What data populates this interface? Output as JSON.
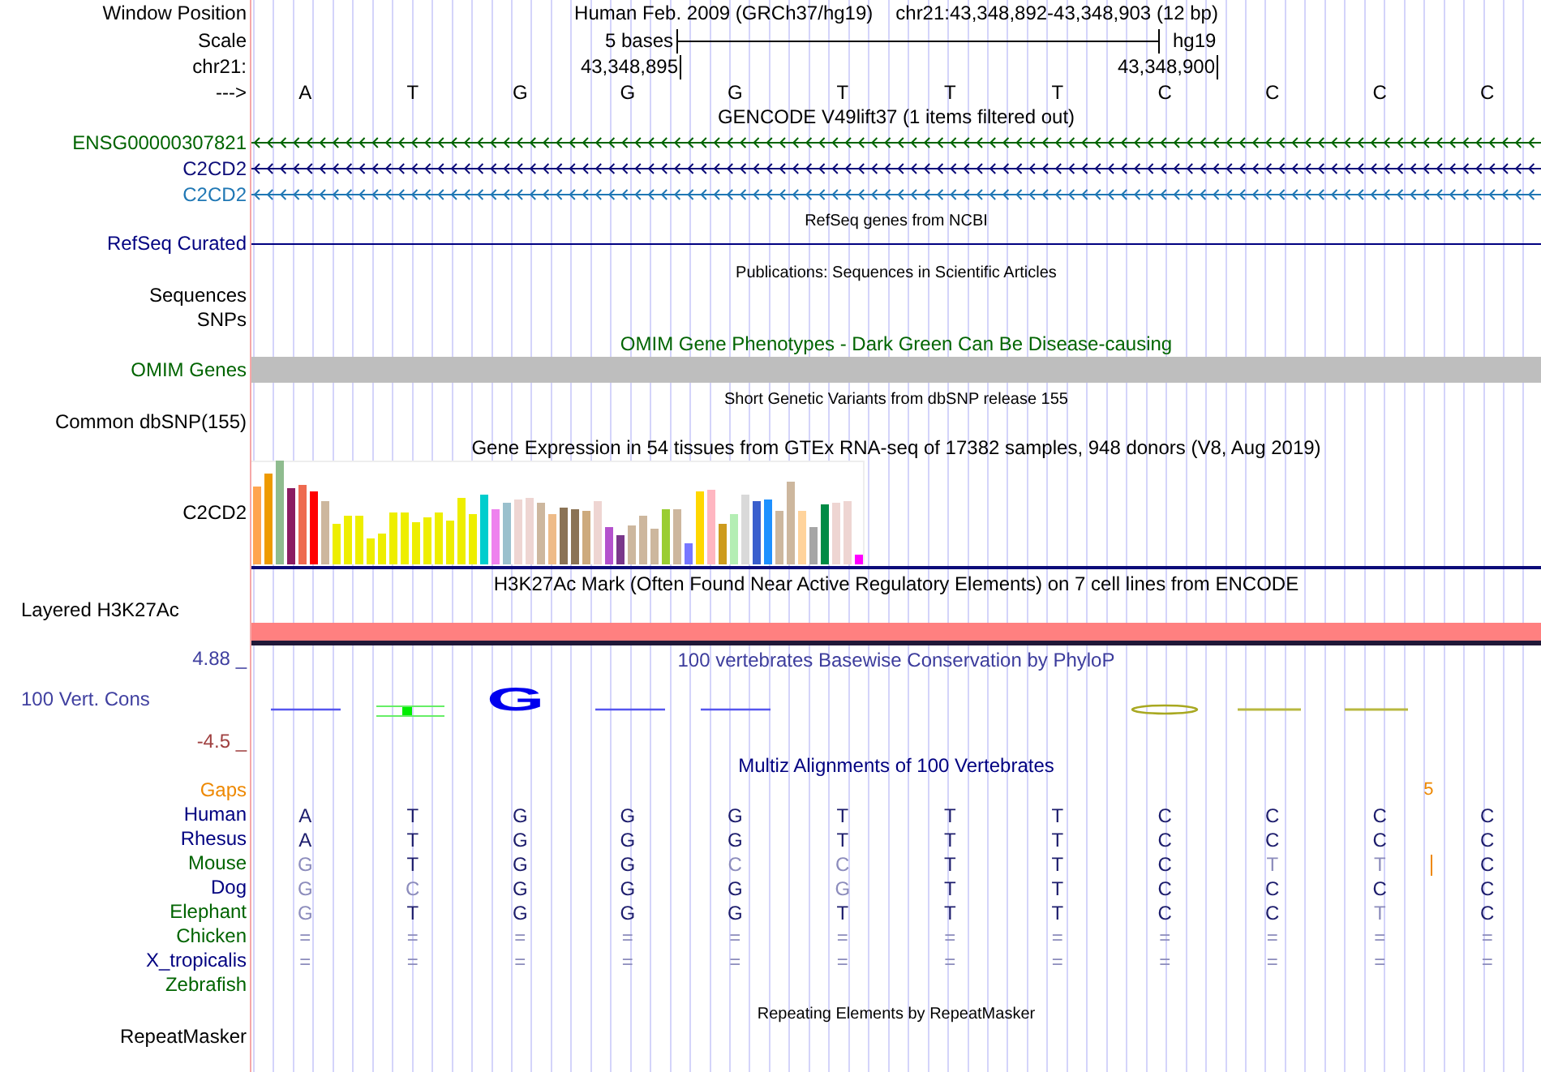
{
  "header": {
    "label": "Window Position",
    "assembly": "Human Feb. 2009 (GRCh37/hg19)",
    "position": "chr21:43,348,892-43,348,903 (12 bp)"
  },
  "scale": {
    "label": "Scale",
    "span": "5 bases",
    "assembly": "hg19"
  },
  "coordinates": {
    "label": "chr21:",
    "ticks": [
      "43,348,895",
      "43,348,900"
    ]
  },
  "bases": {
    "label": "--->",
    "letters": [
      "A",
      "T",
      "G",
      "G",
      "G",
      "T",
      "T",
      "T",
      "C",
      "C",
      "C",
      "C"
    ]
  },
  "tracks": [
    {
      "kind": "genes",
      "title": "GENCODE V49lift37 (1 items filtered out)",
      "items": [
        {
          "name": "ENSG00000307821",
          "color": "#006400"
        },
        {
          "name": "C2CD2",
          "color": "#0c0c78"
        },
        {
          "name": "C2CD2",
          "color": "#1f77b4"
        }
      ]
    },
    {
      "kind": "line",
      "title": "RefSeq genes from NCBI",
      "label": "RefSeq Curated"
    },
    {
      "kind": "empty",
      "title": "Publications: Sequences in Scientific Articles",
      "labels": [
        "Sequences",
        "SNPs"
      ]
    },
    {
      "kind": "bar",
      "title": "OMIM Gene Phenotypes - Dark Green Can Be Disease-causing",
      "label": "OMIM Genes"
    },
    {
      "kind": "empty",
      "title": "Short Genetic Variants from dbSNP release 155",
      "labels": [
        "Common dbSNP(155)"
      ]
    },
    {
      "kind": "expression",
      "title": "Gene Expression in 54 tissues from GTEx RNA-seq of 17382 samples, 948 donors (V8, Aug 2019)",
      "label": "C2CD2"
    },
    {
      "kind": "signal",
      "title": "H3K27Ac Mark (Often Found Near Active Regulatory Elements) on 7 cell lines from ENCODE",
      "label": "Layered H3K27Ac"
    },
    {
      "kind": "conservation",
      "title": "100 vertebrates Basewise Conservation by PhyloP",
      "label": "100 Vert. Cons",
      "max": "4.88 _",
      "min": "-4.5 _",
      "logo": "G"
    },
    {
      "kind": "alignment",
      "title": "Multiz Alignments of 100 Vertebrates",
      "gaps_label": "Gaps",
      "gap_count": "5",
      "species": [
        {
          "name": "Human",
          "color": "#000080",
          "bases": [
            {
              "base": "A",
              "faded": false
            },
            {
              "base": "T",
              "faded": false
            },
            {
              "base": "G",
              "faded": false
            },
            {
              "base": "G",
              "faded": false
            },
            {
              "base": "G",
              "faded": false
            },
            {
              "base": "T",
              "faded": false
            },
            {
              "base": "T",
              "faded": false
            },
            {
              "base": "T",
              "faded": false
            },
            {
              "base": "C",
              "faded": false
            },
            {
              "base": "C",
              "faded": false
            },
            {
              "base": "C",
              "faded": false
            },
            {
              "base": "C",
              "faded": false
            }
          ]
        },
        {
          "name": "Rhesus",
          "color": "#000080",
          "bases": [
            {
              "base": "A",
              "faded": false
            },
            {
              "base": "T",
              "faded": false
            },
            {
              "base": "G",
              "faded": false
            },
            {
              "base": "G",
              "faded": false
            },
            {
              "base": "G",
              "faded": false
            },
            {
              "base": "T",
              "faded": false
            },
            {
              "base": "T",
              "faded": false
            },
            {
              "base": "T",
              "faded": false
            },
            {
              "base": "C",
              "faded": false
            },
            {
              "base": "C",
              "faded": false
            },
            {
              "base": "C",
              "faded": false
            },
            {
              "base": "C",
              "faded": false
            }
          ]
        },
        {
          "name": "Mouse",
          "color": "#006400",
          "insertion": true,
          "bases": [
            {
              "base": "G",
              "faded": true
            },
            {
              "base": "T",
              "faded": false
            },
            {
              "base": "G",
              "faded": false
            },
            {
              "base": "G",
              "faded": false
            },
            {
              "base": "C",
              "faded": true
            },
            {
              "base": "C",
              "faded": true
            },
            {
              "base": "T",
              "faded": false
            },
            {
              "base": "T",
              "faded": false
            },
            {
              "base": "C",
              "faded": false
            },
            {
              "base": "T",
              "faded": true
            },
            {
              "base": "T",
              "faded": true
            },
            {
              "base": "C",
              "faded": false
            }
          ]
        },
        {
          "name": "Dog",
          "color": "#000080",
          "bases": [
            {
              "base": "G",
              "faded": true
            },
            {
              "base": "C",
              "faded": true
            },
            {
              "base": "G",
              "faded": false
            },
            {
              "base": "G",
              "faded": false
            },
            {
              "base": "G",
              "faded": false
            },
            {
              "base": "G",
              "faded": true
            },
            {
              "base": "T",
              "faded": false
            },
            {
              "base": "T",
              "faded": false
            },
            {
              "base": "C",
              "faded": false
            },
            {
              "base": "C",
              "faded": false
            },
            {
              "base": "C",
              "faded": false
            },
            {
              "base": "C",
              "faded": false
            }
          ]
        },
        {
          "name": "Elephant",
          "color": "#006400",
          "bases": [
            {
              "base": "G",
              "faded": true
            },
            {
              "base": "T",
              "faded": false
            },
            {
              "base": "G",
              "faded": false
            },
            {
              "base": "G",
              "faded": false
            },
            {
              "base": "G",
              "faded": false
            },
            {
              "base": "T",
              "faded": false
            },
            {
              "base": "T",
              "faded": false
            },
            {
              "base": "T",
              "faded": false
            },
            {
              "base": "C",
              "faded": false
            },
            {
              "base": "C",
              "faded": false
            },
            {
              "base": "T",
              "faded": true
            },
            {
              "base": "C",
              "faded": false
            }
          ]
        },
        {
          "name": "Chicken",
          "color": "#006400",
          "bases": [
            {
              "base": "=",
              "faded": true
            },
            {
              "base": "=",
              "faded": true
            },
            {
              "base": "=",
              "faded": true
            },
            {
              "base": "=",
              "faded": true
            },
            {
              "base": "=",
              "faded": true
            },
            {
              "base": "=",
              "faded": true
            },
            {
              "base": "=",
              "faded": true
            },
            {
              "base": "=",
              "faded": true
            },
            {
              "base": "=",
              "faded": true
            },
            {
              "base": "=",
              "faded": true
            },
            {
              "base": "=",
              "faded": true
            },
            {
              "base": "=",
              "faded": true
            }
          ]
        },
        {
          "name": "X_tropicalis",
          "color": "#000080",
          "bases": [
            {
              "base": "=",
              "faded": true
            },
            {
              "base": "=",
              "faded": true
            },
            {
              "base": "=",
              "faded": true
            },
            {
              "base": "=",
              "faded": true
            },
            {
              "base": "=",
              "faded": true
            },
            {
              "base": "=",
              "faded": true
            },
            {
              "base": "=",
              "faded": true
            },
            {
              "base": "=",
              "faded": true
            },
            {
              "base": "=",
              "faded": true
            },
            {
              "base": "=",
              "faded": true
            },
            {
              "base": "=",
              "faded": true
            },
            {
              "base": "=",
              "faded": true
            }
          ]
        },
        {
          "name": "Zebrafish",
          "color": "#006400"
        }
      ]
    },
    {
      "kind": "empty",
      "title": "Repeating Elements by RepeatMasker",
      "labels": [
        "RepeatMasker"
      ]
    }
  ]
}
